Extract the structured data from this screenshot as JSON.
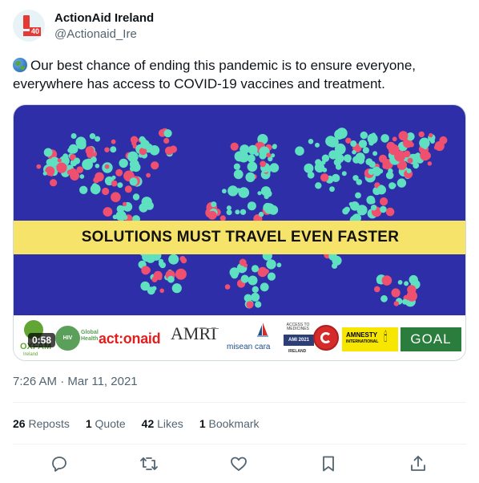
{
  "author": {
    "name": "ActionAid Ireland",
    "handle": "@Actionaid_Ire",
    "avatar_badge": "40"
  },
  "tweet": {
    "text": "Our best chance of ending this pandemic is to ensure everyone, everywhere has access to COVID-19 vaccines and treatment."
  },
  "media": {
    "banner_text": "SOLUTIONS MUST TRAVEL EVEN FASTER",
    "video_time": "0:58",
    "logos": {
      "oxfam": "OXFAM",
      "oxfam_sub": "Ireland",
      "hiv_line1": "Global",
      "hiv_line2": "Health",
      "hiv_circle": "HIV",
      "actionaid": "act:onaid",
      "amri": "AMRI",
      "misean": "misean cara",
      "ami_top": "ACCESS TO MEDICINES",
      "ami_box": "AMI 2021",
      "ami_bottom": "IRELAND",
      "amnesty_line1": "AMNESTY",
      "amnesty_line2": "INTERNATIONAL",
      "goal": "GOAL"
    },
    "colors": {
      "map_bg": "#2e2ea8",
      "dot_teal": "#5fe0c0",
      "dot_pink": "#f05070",
      "banner": "#f5e36a"
    }
  },
  "timestamp": "7:26 AM · Mar 11, 2021",
  "stats": {
    "reposts_count": "26",
    "reposts_label": "Reposts",
    "quotes_count": "1",
    "quotes_label": "Quote",
    "likes_count": "42",
    "likes_label": "Likes",
    "bookmarks_count": "1",
    "bookmarks_label": "Bookmark"
  },
  "actions": [
    "reply-icon",
    "repost-icon",
    "like-icon",
    "bookmark-icon",
    "share-icon"
  ]
}
